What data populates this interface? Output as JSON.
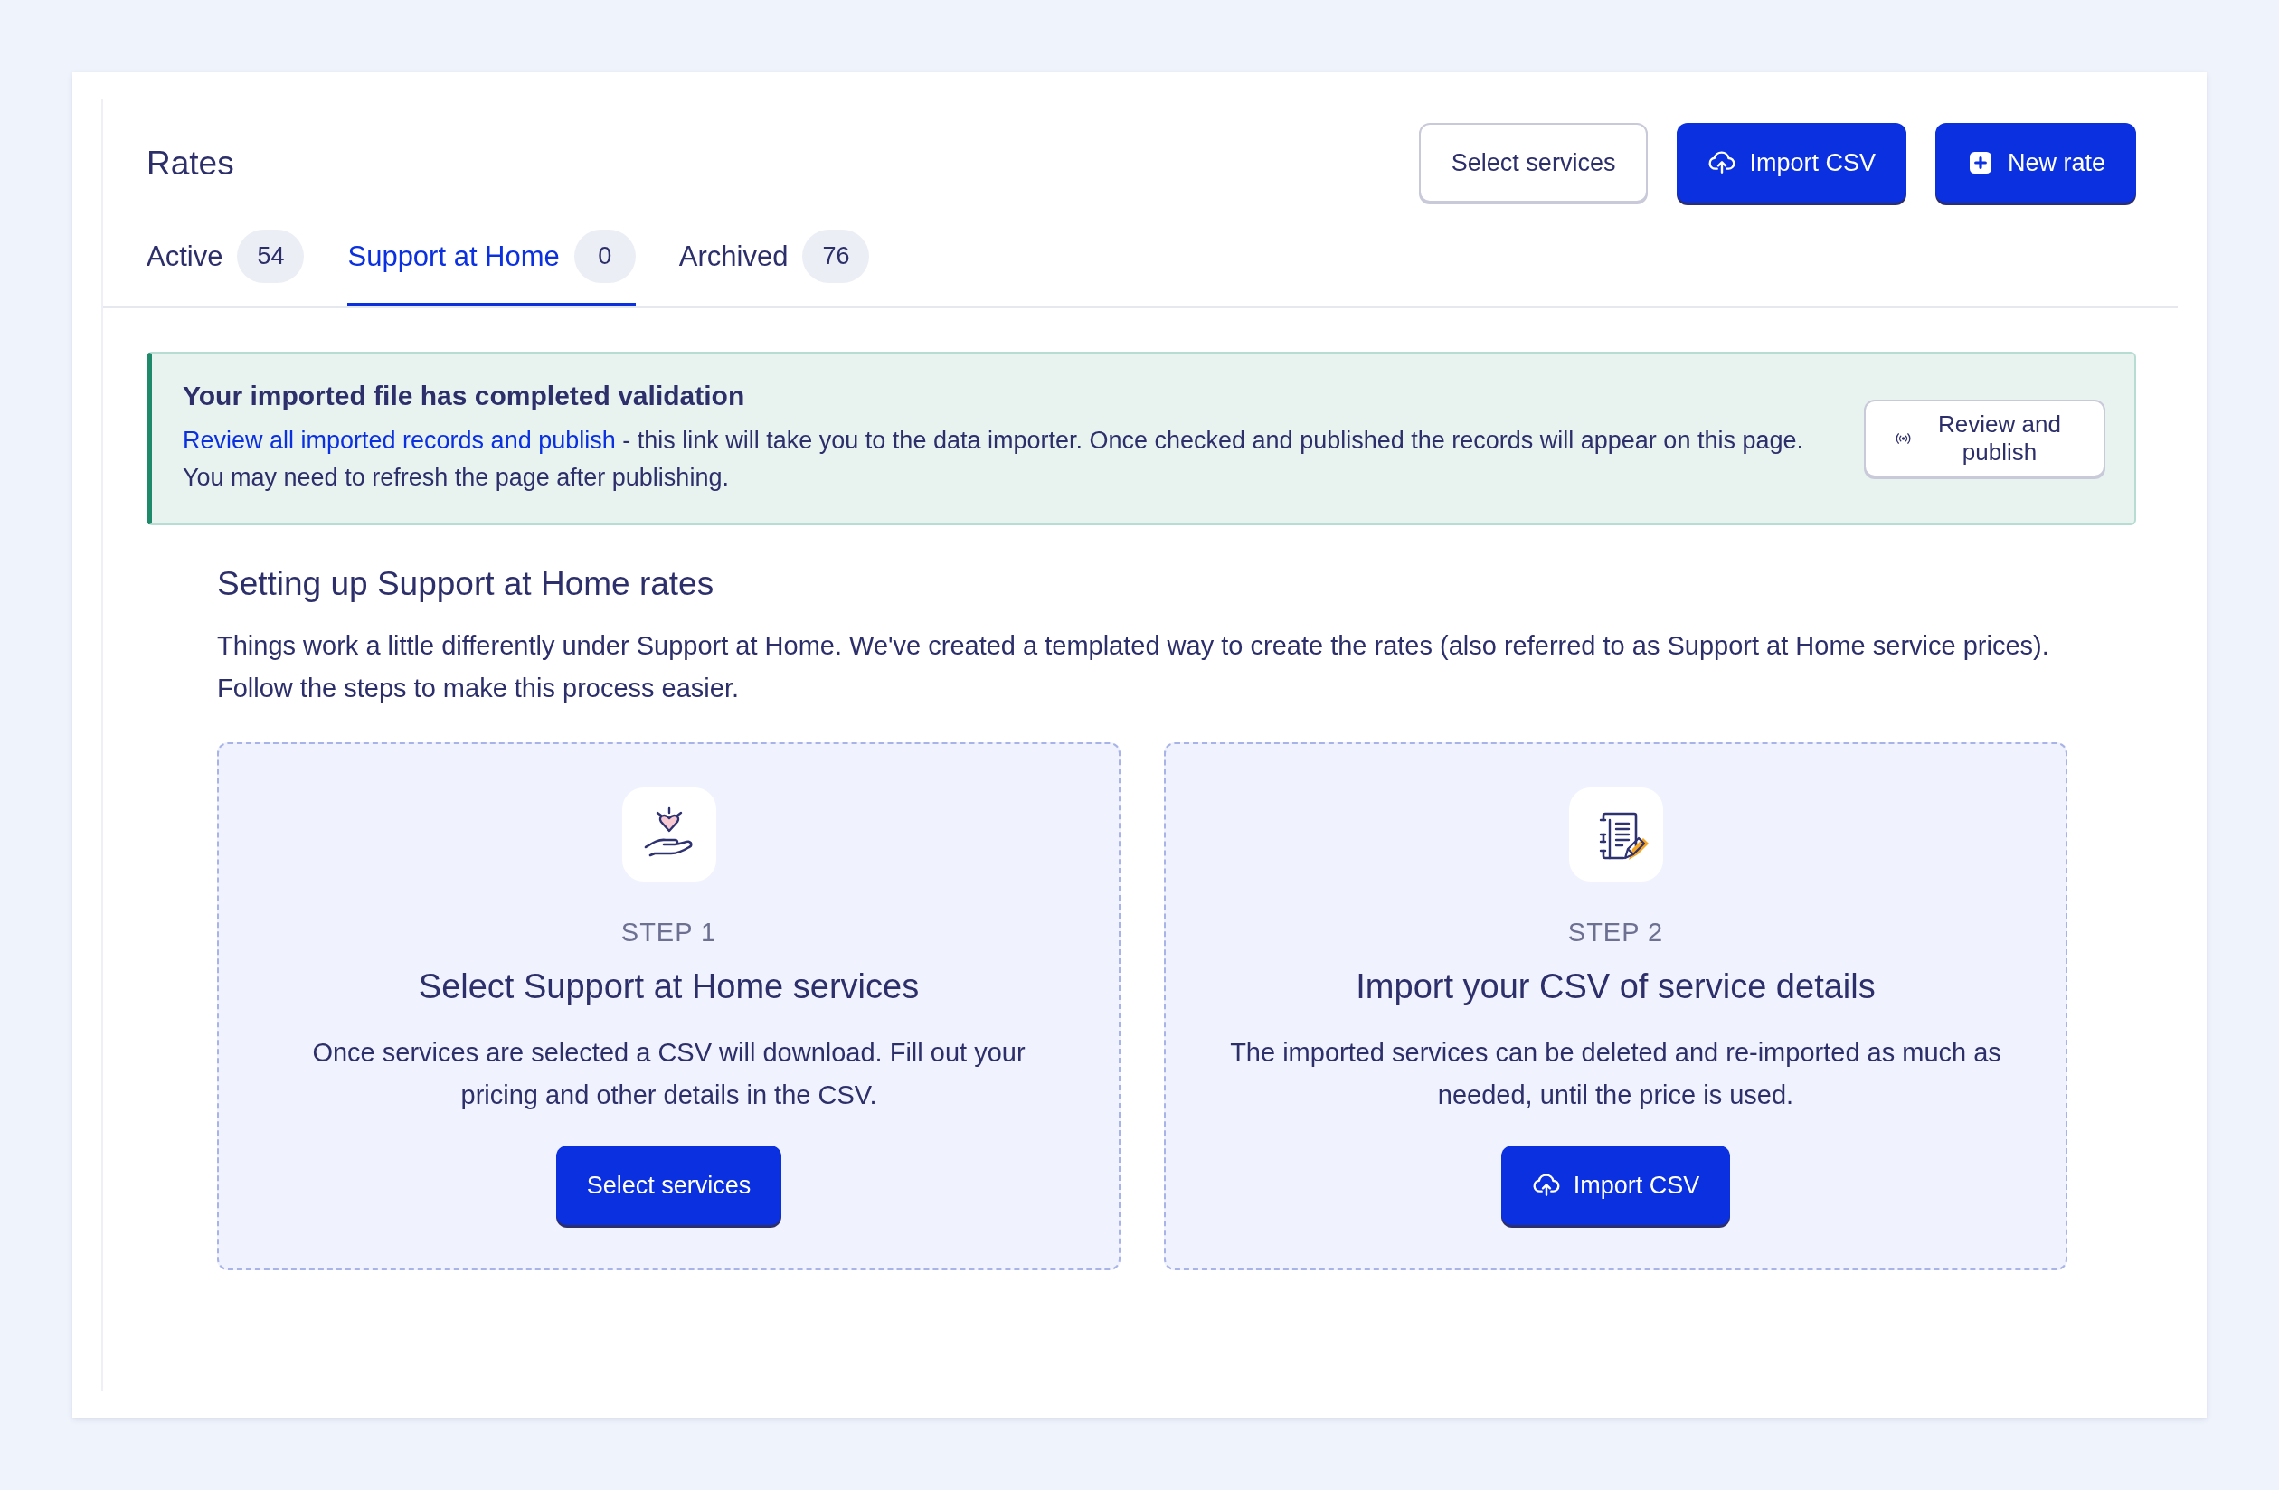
{
  "page": {
    "title": "Rates"
  },
  "actions": [
    {
      "label": "Select services",
      "kind": "plain"
    },
    {
      "label": "Import CSV",
      "kind": "upload"
    },
    {
      "label": "New rate",
      "kind": "add"
    }
  ],
  "tabs": [
    {
      "label": "Active",
      "count": "54",
      "selected": false
    },
    {
      "label": "Support at Home",
      "count": "0",
      "selected": true
    },
    {
      "label": "Archived",
      "count": "76",
      "selected": false
    }
  ],
  "banner": {
    "title": "Your imported file has completed validation",
    "link": "Review all imported records and publish",
    "text": " - this link will take you to the data importer. Once checked and published the records will appear on this page. You may need to refresh the page after publishing.",
    "button": "Review and publish"
  },
  "setup": {
    "title": "Setting up Support at Home rates",
    "text": "Things work a little differently under Support at Home. We've created a templated way to create the rates (also referred to as Support at Home service prices). Follow the steps to make this process easier.",
    "steps": [
      {
        "kind": "care",
        "step": "STEP 1",
        "title": "Select Support at Home services",
        "text": "Once services are selected a CSV will download. Fill out your pricing and other details in the CSV.",
        "button": {
          "label": "Select services",
          "kind": "plain"
        }
      },
      {
        "kind": "document",
        "step": "STEP 2",
        "title": "Import your CSV of service details",
        "text": "The imported services can be deleted and re-imported as much as needed, until the price is used.",
        "button": {
          "label": "Import CSV",
          "kind": "upload"
        }
      }
    ]
  }
}
